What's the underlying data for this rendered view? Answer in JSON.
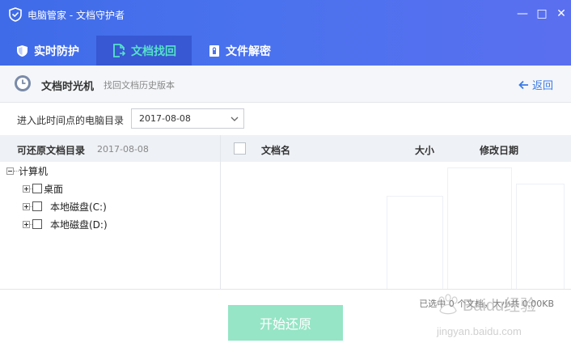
{
  "window": {
    "title": "电脑管家 - 文档守护者",
    "minimize": "—",
    "maximize": "□",
    "close": "✕"
  },
  "tabs": [
    {
      "label": "实时防护",
      "icon": "shield-icon",
      "active": false
    },
    {
      "label": "文档找回",
      "icon": "document-restore-icon",
      "active": true
    },
    {
      "label": "文件解密",
      "icon": "file-lock-icon",
      "active": false
    }
  ],
  "subheader": {
    "title": "文档时光机",
    "subtitle": "找回文档历史版本",
    "back_label": "返回"
  },
  "date_selector": {
    "label": "进入此时间点的电脑目录",
    "value": "2017-08-08"
  },
  "left_panel": {
    "title": "可还原文档目录",
    "date": "2017-08-08",
    "tree": [
      {
        "label": "计算机",
        "level": 0,
        "expander": "minus",
        "checkbox": false
      },
      {
        "label": "桌面",
        "level": 1,
        "expander": "plus",
        "checkbox": true
      },
      {
        "label": "本地磁盘(C:)",
        "level": 1,
        "expander": "plus",
        "checkbox": true
      },
      {
        "label": "本地磁盘(D:)",
        "level": 1,
        "expander": "plus",
        "checkbox": true
      }
    ]
  },
  "right_panel": {
    "columns": {
      "name": "文档名",
      "size": "大小",
      "date": "修改日期"
    }
  },
  "footer": {
    "status": "已选中 0 个文档，大小共 0.00KB",
    "start_button": "开始还原"
  },
  "watermark": {
    "brand": "Baidu经验",
    "url": "jingyan.baidu.com"
  },
  "colors": {
    "header": "#4a72ee",
    "active_tab": "#3758d2",
    "active_tab_text": "#55e1c9",
    "button": "#95e5c6",
    "link": "#3b7ae6"
  }
}
